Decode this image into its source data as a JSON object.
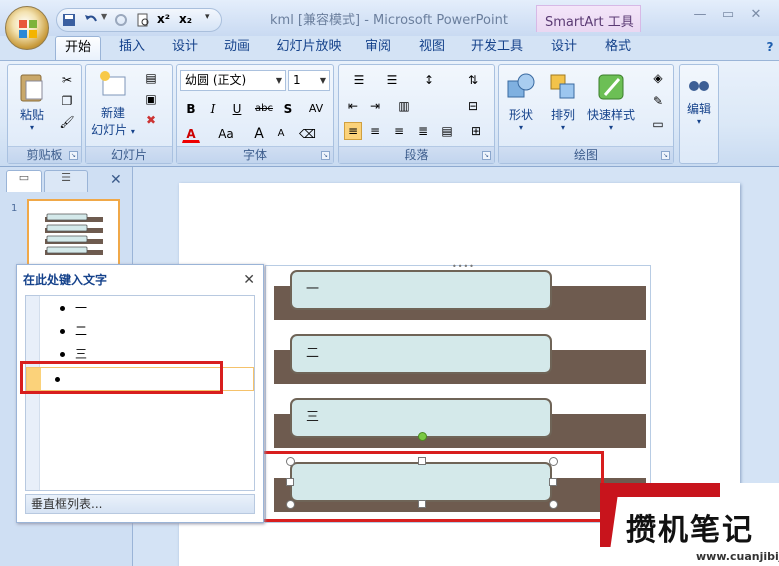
{
  "window": {
    "title": "kml [兼容模式] - Microsoft PowerPoint",
    "contextual_tab_group": "SmartArt 工具",
    "controls": [
      "minimize-icon",
      "maximize-icon",
      "close-icon"
    ]
  },
  "qat": {
    "icons": [
      "save-icon",
      "undo-icon",
      "redo-icon",
      "print-preview-icon",
      "superscript-icon",
      "subscript-icon",
      "customize-qat-icon"
    ]
  },
  "tabs": [
    {
      "label": "开始",
      "active": true
    },
    {
      "label": "插入"
    },
    {
      "label": "设计"
    },
    {
      "label": "动画"
    },
    {
      "label": "幻灯片放映"
    },
    {
      "label": "审阅"
    },
    {
      "label": "视图"
    },
    {
      "label": "开发工具"
    },
    {
      "label": "设计"
    },
    {
      "label": "格式"
    }
  ],
  "ribbon": {
    "clipboard": {
      "label": "剪贴板",
      "paste": "粘贴"
    },
    "slides": {
      "label": "幻灯片",
      "new_slide": "新建",
      "new_slide2": "幻灯片"
    },
    "font": {
      "label": "字体",
      "font_name": "幼圆 (正文)",
      "font_size": "1",
      "bold": "B",
      "italic": "I",
      "underline": "U",
      "strike": "abc",
      "shadow": "S",
      "spacing": "AV",
      "color": "A",
      "case": "Aa",
      "grow": "A",
      "shrink": "A"
    },
    "paragraph": {
      "label": "段落"
    },
    "drawing": {
      "label": "绘图",
      "shapes": "形状",
      "arrange": "排列",
      "quick_styles": "快速样式"
    },
    "editing": {
      "label": "编辑"
    }
  },
  "slide_pane": {
    "slide_number": "1"
  },
  "text_pane": {
    "title": "在此处键入文字",
    "items": [
      "一",
      "二",
      "三",
      ""
    ],
    "footer": "垂直框列表..."
  },
  "smartart": {
    "items": [
      "一",
      "二",
      "三",
      ""
    ],
    "selected_index": 3
  },
  "watermark": {
    "text": "攒机笔记",
    "url": "www.cuanjibiji.com"
  },
  "colors": {
    "accent": "#15428b",
    "band": "#6e5b4f",
    "card": "#d4e9ea",
    "highlight": "#d81e1e"
  }
}
